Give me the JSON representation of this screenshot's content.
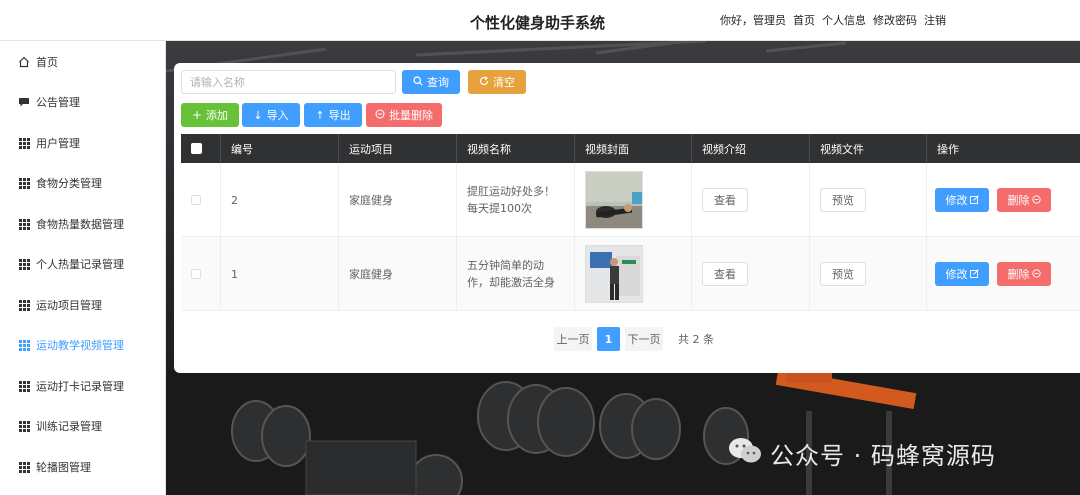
{
  "header": {
    "title": "个性化健身助手系统",
    "nav": [
      "你好，管理员",
      "首页",
      "个人信息",
      "修改密码",
      "注销"
    ]
  },
  "sidebar": {
    "items": [
      {
        "label": "首页",
        "icon": "home-icon"
      },
      {
        "label": "公告管理",
        "icon": "chat-icon"
      },
      {
        "label": "用户管理",
        "icon": "grid-icon"
      },
      {
        "label": "食物分类管理",
        "icon": "grid-icon"
      },
      {
        "label": "食物热量数据管理",
        "icon": "grid-icon"
      },
      {
        "label": "个人热量记录管理",
        "icon": "grid-icon"
      },
      {
        "label": "运动项目管理",
        "icon": "grid-icon"
      },
      {
        "label": "运动教学视频管理",
        "icon": "grid-icon",
        "active": true
      },
      {
        "label": "运动打卡记录管理",
        "icon": "grid-icon"
      },
      {
        "label": "训练记录管理",
        "icon": "grid-icon"
      },
      {
        "label": "轮播图管理",
        "icon": "grid-icon"
      }
    ]
  },
  "search": {
    "placeholder": "请输入名称",
    "value": "",
    "query_label": "查询",
    "clear_label": "清空"
  },
  "toolbar": {
    "add_label": "添加",
    "import_label": "导入",
    "export_label": "导出",
    "batch_delete_label": "批量删除"
  },
  "table": {
    "columns": [
      "编号",
      "运动项目",
      "视频名称",
      "视频封面",
      "视频介绍",
      "视频文件",
      "操作"
    ],
    "rows": [
      {
        "id": "2",
        "project": "家庭健身",
        "name": "提肛运动好处多！每天提100次",
        "intro_btn": "查看",
        "file_btn": "预览",
        "edit": "修改",
        "delete": "删除"
      },
      {
        "id": "1",
        "project": "家庭健身",
        "name": "五分钟简单的动作，却能激活全身",
        "intro_btn": "查看",
        "file_btn": "预览",
        "edit": "修改",
        "delete": "删除"
      }
    ]
  },
  "pagination": {
    "prev": "上一页",
    "current": "1",
    "next": "下一页",
    "total": "共 2 条"
  },
  "watermark": "公众号 · 码蜂窝源码",
  "colors": {
    "primary": "#409eff",
    "success": "#67c23a",
    "warning": "#e6a23c",
    "danger": "#f56c6c",
    "table_header": "#303133"
  }
}
